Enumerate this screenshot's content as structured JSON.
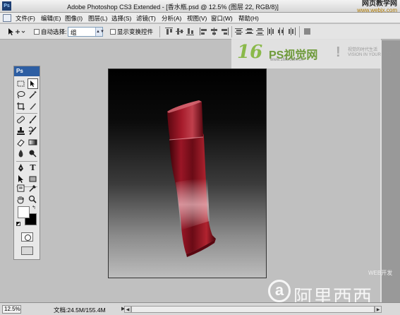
{
  "window": {
    "title": "Adobe Photoshop CS3 Extended - [香水瓶.psd @ 12.5% (图层 22, RGB/8)]",
    "app_icon_label": "Ps"
  },
  "watermark_top": {
    "name": "网页教学网",
    "url": "www.webjx.com"
  },
  "menu": {
    "items": [
      "文件(F)",
      "编辑(E)",
      "图像(I)",
      "图层(L)",
      "选择(S)",
      "滤镜(T)",
      "分析(A)",
      "视图(V)",
      "窗口(W)",
      "帮助(H)"
    ]
  },
  "options": {
    "auto_select_label": "自动选择:",
    "auto_select_value": "组",
    "show_transform_label": "显示变换控件",
    "auto_select_checked": false,
    "show_transform_checked": false
  },
  "toolbox": {
    "header": "Ps"
  },
  "ps_logo": {
    "number": "16",
    "name": "PS视觉网",
    "url": "www.16fs.com.cn",
    "tagline_1": "视觉的时代生活",
    "tagline_2": "VISION IN YOUR LIFE"
  },
  "watermark_bottom": {
    "small": "WEB开发",
    "letter": "a",
    "name": "阿里西西"
  },
  "status": {
    "zoom": "12.5%",
    "doc_info": "文档:24.5M/155.4M"
  },
  "colors": {
    "foreground": "#ffffff",
    "background": "#000000",
    "bottle": "#8b1220"
  }
}
